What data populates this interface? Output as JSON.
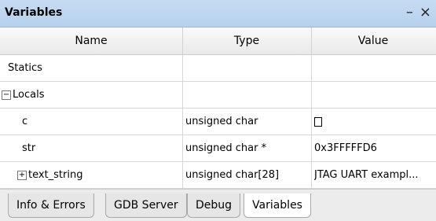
{
  "panel": {
    "title": "Variables",
    "minimize_glyph": "–",
    "close_glyph": "×"
  },
  "columns": [
    "Name",
    "Type",
    "Value"
  ],
  "rows": [
    {
      "name": "Statics",
      "type": "",
      "value": ""
    },
    {
      "name": "Locals",
      "type": "",
      "value": "",
      "expander": "−"
    },
    {
      "name": "c",
      "type": "unsigned char",
      "value": ""
    },
    {
      "name": "str",
      "type": "unsigned char *",
      "value": "0x3FFFFFD6"
    },
    {
      "name": "text_string",
      "type": "unsigned char[28]",
      "value": "JTAG UART exampl...",
      "expander": "+"
    }
  ],
  "tabs": [
    "Info & Errors",
    "GDB Server",
    "Debug",
    "Variables"
  ],
  "active_tab": "Variables",
  "icons": {
    "minimize": "minimize-icon",
    "close": "close-icon",
    "collapse": "minus-box-icon",
    "expand": "plus-box-icon",
    "char_glyph": "box-glyph-icon"
  }
}
